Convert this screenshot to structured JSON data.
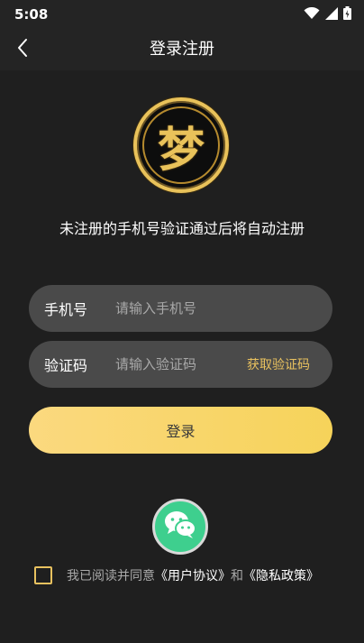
{
  "status_bar": {
    "time": "5:08"
  },
  "nav": {
    "title": "登录注册"
  },
  "logo": {
    "glyph": "梦"
  },
  "subtitle": "未注册的手机号验证通过后将自动注册",
  "phone_field": {
    "label": "手机号",
    "placeholder": "请输入手机号",
    "value": ""
  },
  "code_field": {
    "label": "验证码",
    "placeholder": "请输入验证码",
    "value": "",
    "get_code_label": "获取验证码"
  },
  "login_button": {
    "label": "登录"
  },
  "agreement": {
    "checked": false,
    "prefix": "我已阅读并同意",
    "user_agreement": "《用户协议》",
    "conjunction": "和",
    "privacy_policy": "《隐私政策》"
  },
  "colors": {
    "background": "#1f1f1f",
    "field_background": "#4a4a4a",
    "accent_gold": "#e8c15f",
    "login_gradient_start": "#fbd97f",
    "login_gradient_end": "#f6d35a",
    "wechat_green": "#3ecf8e"
  },
  "icons": {
    "back": "chevron-left-icon",
    "wechat": "wechat-icon",
    "wifi": "wifi-icon",
    "signal": "signal-icon",
    "battery": "battery-icon"
  }
}
